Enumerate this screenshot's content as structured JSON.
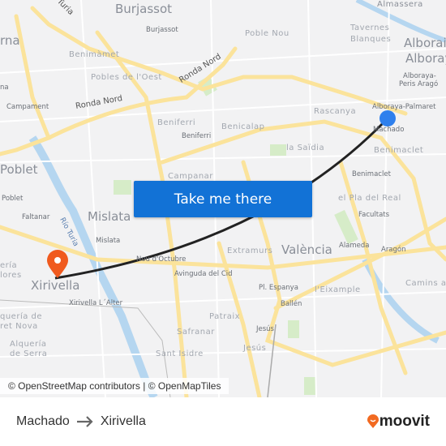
{
  "map": {
    "labels": [
      "Burjassot",
      "Burjassot",
      "Benimàmet",
      "Pobles de l'Oest",
      "Ronda Nord",
      "Ronda Nord",
      "Campament",
      "Beniferri",
      "Beniferri",
      "Campanar",
      "Poblet",
      "Poblet",
      "Faltanar",
      "Mislata",
      "Mislata",
      "Río Turia",
      "Nou d'Octubre",
      "Avinguda del Cid",
      "Xirivella",
      "Xirivella L´Alter",
      "Safranar",
      "Sant Isidre",
      "Alquería",
      "de Serra",
      "quería de",
      "ret Nova",
      "ería",
      "lores",
      "rna",
      "na",
      "Turia",
      "Poble Nou",
      "Tavernes",
      "Blanques",
      "Alboraia",
      "Alboraya",
      "Alboraya-",
      "Peris Aragó",
      "Alboraya-Palmaret",
      "Machado",
      "Rascanya",
      "Benicalap",
      "la Saïdia",
      "Benimaclet",
      "Benimaclet",
      "el Pla del Real",
      "Facultats",
      "Alameda",
      "Aragón",
      "València",
      "Extramurs",
      "Camins a",
      "Pl. Espanya",
      "Ballén",
      "l'Eixample",
      "Patraix",
      "Jesús",
      "Jesús",
      "Almassera"
    ],
    "cta_label": "Take me there",
    "attribution": "© OpenStreetMap contributors | © OpenMapTiles",
    "origin_marker_color": "#2f80ed",
    "destination_marker_color": "#f05a1e",
    "route_color": "#222222"
  },
  "footer": {
    "origin": "Machado",
    "destination": "Xirivella",
    "arrow_icon": "arrow-right-icon",
    "brand": "moovit",
    "brand_color": "#f26a21"
  }
}
